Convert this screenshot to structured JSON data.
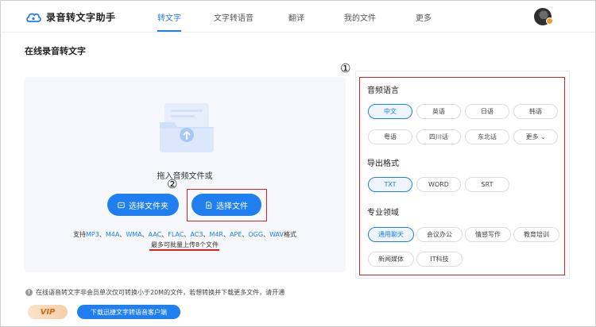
{
  "app": {
    "name": "录音转文字助手"
  },
  "nav": {
    "items": [
      {
        "label": "转文字",
        "active": true
      },
      {
        "label": "文字转语音",
        "active": false
      },
      {
        "label": "翻译",
        "active": false
      },
      {
        "label": "我的文件",
        "active": false
      },
      {
        "label": "更多",
        "active": false
      }
    ]
  },
  "page": {
    "title": "在线录音转文字"
  },
  "upload": {
    "drop_hint": "拖入音频文件或",
    "select_folder_label": "选择文件夹",
    "select_file_label": "选择文件",
    "formats_prefix": "支持",
    "formats": [
      "MP3",
      "M4A",
      "WMA",
      "AAC",
      "FLAC",
      "AC3",
      "M4R",
      "APE",
      "OGG",
      "WAV"
    ],
    "formats_suffix": "格式",
    "limit_text": "最多可批量上传8个文件"
  },
  "annotations": {
    "one": "①",
    "two": "②"
  },
  "settings": {
    "language": {
      "title": "音频语言",
      "options": [
        "中文",
        "英语",
        "日语",
        "韩语",
        "粤语",
        "四川话",
        "东北话",
        "更多"
      ],
      "selected": "中文"
    },
    "export": {
      "title": "导出格式",
      "options": [
        "TXT",
        "WORD",
        "SRT"
      ],
      "selected": "TXT"
    },
    "domain": {
      "title": "专业领域",
      "options": [
        "通用聊天",
        "会议办公",
        "情感写作",
        "教育培训",
        "新闻媒体",
        "IT科技"
      ],
      "selected": "通用聊天"
    }
  },
  "footer": {
    "notice": "在线语音转文字非会员单次仅可转换小于20M的文件，若想转换并下载更多文件，请开通",
    "vip_label": "VIP",
    "download_label": "下载迅捷文字转语音客户端"
  },
  "colors": {
    "accent": "#1f7ff0",
    "annotation": "#e02020"
  },
  "icons": {
    "logo": "cloud-logo-icon",
    "folder": "folder-icon",
    "file": "file-icon",
    "upload": "upload-illustration-icon",
    "info": "info-icon",
    "more": "chevron-down-icon"
  }
}
